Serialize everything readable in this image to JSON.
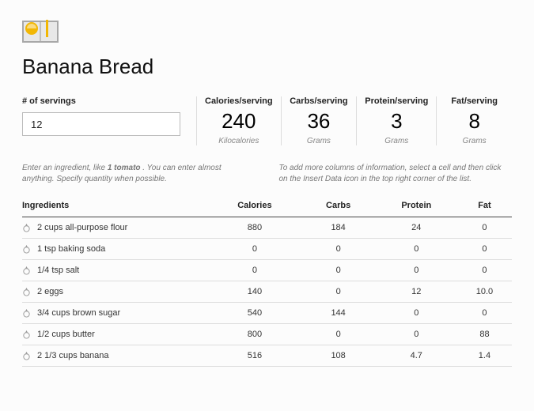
{
  "title": "Banana Bread",
  "servings": {
    "label": "# of servings",
    "value": "12"
  },
  "stats": [
    {
      "label": "Calories/serving",
      "value": "240",
      "unit": "Kilocalories"
    },
    {
      "label": "Carbs/serving",
      "value": "36",
      "unit": "Grams"
    },
    {
      "label": "Protein/serving",
      "value": "3",
      "unit": "Grams"
    },
    {
      "label": "Fat/serving",
      "value": "8",
      "unit": "Grams"
    }
  ],
  "hints": {
    "left_pre": "Enter an ingredient, like ",
    "left_bold": "1 tomato",
    "left_post": " . You can enter almost anything. Specify quantity when possible.",
    "right": "To add more columns of information, select a cell and then click on the Insert Data icon in the top right corner of the list."
  },
  "table": {
    "headers": [
      "Ingredients",
      "Calories",
      "Carbs",
      "Protein",
      "Fat"
    ],
    "rows": [
      {
        "name": "2 cups all-purpose flour",
        "cal": "880",
        "carbs": "184",
        "protein": "24",
        "fat": "0"
      },
      {
        "name": "1 tsp baking soda",
        "cal": "0",
        "carbs": "0",
        "protein": "0",
        "fat": "0"
      },
      {
        "name": "1/4 tsp salt",
        "cal": "0",
        "carbs": "0",
        "protein": "0",
        "fat": "0"
      },
      {
        "name": "2 eggs",
        "cal": "140",
        "carbs": "0",
        "protein": "12",
        "fat": "10.0"
      },
      {
        "name": "3/4 cups brown sugar",
        "cal": "540",
        "carbs": "144",
        "protein": "0",
        "fat": "0"
      },
      {
        "name": "1/2 cups butter",
        "cal": "800",
        "carbs": "0",
        "protein": "0",
        "fat": "88"
      },
      {
        "name": "2 1/3 cups banana",
        "cal": "516",
        "carbs": "108",
        "protein": "4.7",
        "fat": "1.4"
      }
    ]
  }
}
